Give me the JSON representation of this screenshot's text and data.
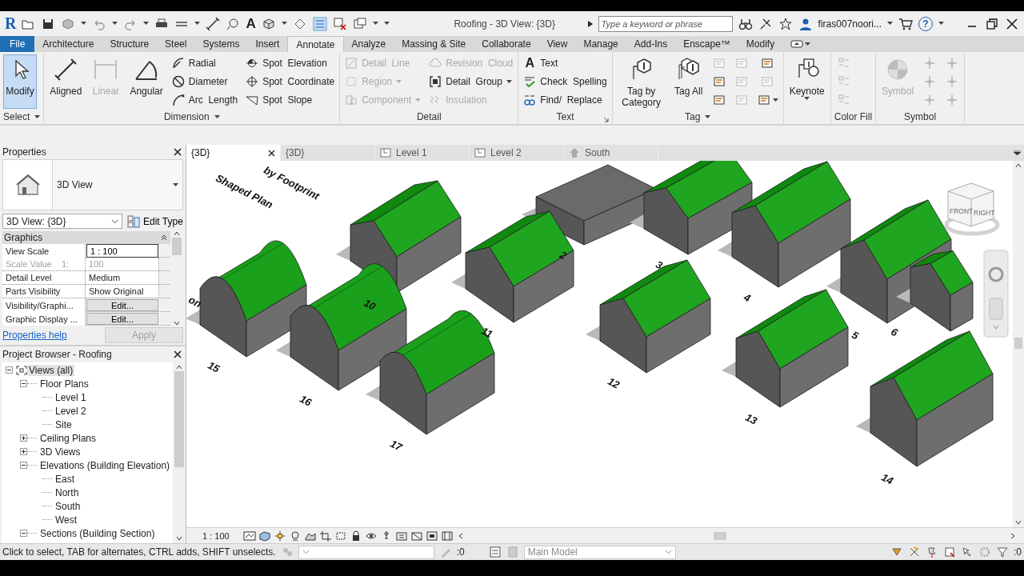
{
  "quick_access": {
    "logo": "R",
    "glyph": "A",
    "title": "Roofing - 3D View: {3D}",
    "search": {
      "placeholder": "Type a keyword or phrase"
    },
    "user": "firas007noori...",
    "help": "?"
  },
  "ribbon_tabs": [
    {
      "label": "File",
      "kind": "file",
      "selected": false
    },
    {
      "label": "Architecture",
      "kind": "tab",
      "selected": false
    },
    {
      "label": "Structure",
      "kind": "tab",
      "selected": false
    },
    {
      "label": "Steel",
      "kind": "tab",
      "selected": false
    },
    {
      "label": "Systems",
      "kind": "tab",
      "selected": false
    },
    {
      "label": "Insert",
      "kind": "tab",
      "selected": false
    },
    {
      "label": "Annotate",
      "kind": "tab",
      "selected": true
    },
    {
      "label": "Analyze",
      "kind": "tab",
      "selected": false
    },
    {
      "label": "Massing & Site",
      "kind": "tab",
      "selected": false
    },
    {
      "label": "Collaborate",
      "kind": "tab",
      "selected": false
    },
    {
      "label": "View",
      "kind": "tab",
      "selected": false
    },
    {
      "label": "Manage",
      "kind": "tab",
      "selected": false
    },
    {
      "label": "Add-Ins",
      "kind": "tab",
      "selected": false
    },
    {
      "label": "Enscape™",
      "kind": "tab",
      "selected": false
    },
    {
      "label": "Modify",
      "kind": "tab",
      "selected": false
    }
  ],
  "ribbon_panels": [
    {
      "title": "Select",
      "menu": true,
      "launcher": false,
      "columns": [
        [
          {
            "label": "Modify",
            "kind": "large",
            "selected": true,
            "disabled": false
          }
        ]
      ]
    },
    {
      "title": "Dimension",
      "menu": true,
      "launcher": false,
      "columns": [
        [
          {
            "label": "Aligned",
            "kind": "large",
            "disabled": false
          }
        ],
        [
          {
            "label": "Linear",
            "kind": "large",
            "disabled": true
          }
        ],
        [
          {
            "label": "Angular",
            "kind": "large",
            "disabled": false
          }
        ],
        [
          {
            "label": "Radial",
            "kind": "small",
            "disabled": false
          },
          {
            "label": "Diameter",
            "kind": "small",
            "disabled": false
          },
          {
            "label": "Arc  Length",
            "kind": "small",
            "disabled": false
          }
        ],
        [
          {
            "label": "Spot  Elevation",
            "kind": "small",
            "disabled": false
          },
          {
            "label": "Spot  Coordinate",
            "kind": "small",
            "disabled": false
          },
          {
            "label": "Spot  Slope",
            "kind": "small",
            "disabled": false
          }
        ]
      ]
    },
    {
      "title": "Detail",
      "menu": false,
      "launcher": false,
      "columns": [
        [
          {
            "label": "Detail  Line",
            "kind": "small",
            "disabled": true
          },
          {
            "label": "Region",
            "kind": "small",
            "disabled": true,
            "dropdown": true
          },
          {
            "label": "Component",
            "kind": "small",
            "disabled": true,
            "dropdown": true
          }
        ],
        [
          {
            "label": "Revision  Cloud",
            "kind": "small",
            "disabled": true
          },
          {
            "label": "Detail  Group",
            "kind": "small",
            "disabled": false,
            "dropdown": true
          },
          {
            "label": "Insulation",
            "kind": "small",
            "disabled": true
          }
        ]
      ]
    },
    {
      "title": "Text",
      "menu": false,
      "launcher": true,
      "columns": [
        [
          {
            "label": "Text",
            "kind": "small",
            "glyph": "A",
            "disabled": false
          },
          {
            "label": "Check  Spelling",
            "kind": "small",
            "disabled": false
          },
          {
            "label": "Find/  Replace",
            "kind": "small",
            "disabled": false
          }
        ]
      ]
    },
    {
      "title": "Tag",
      "menu": true,
      "launcher": false,
      "columns": [
        [
          {
            "label": "Tag by Category",
            "kind": "large",
            "disabled": false
          }
        ],
        [
          {
            "label": "Tag All",
            "kind": "large",
            "disabled": false
          }
        ],
        [
          {
            "kind": "icon",
            "disabled": true
          },
          {
            "kind": "icon",
            "disabled": false
          },
          {
            "kind": "icon",
            "disabled": false
          }
        ],
        [
          {
            "kind": "icon",
            "disabled": true
          },
          {
            "kind": "icon",
            "disabled": true
          },
          {
            "kind": "icon",
            "disabled": true
          }
        ],
        [
          {
            "kind": "icon",
            "disabled": false
          },
          {
            "kind": "icon",
            "disabled": true
          },
          {
            "kind": "icon",
            "disabled": false,
            "dropdown": true
          }
        ]
      ]
    },
    {
      "menu": false,
      "launcher": false,
      "columns": [
        [
          {
            "label": "Keynote",
            "kind": "large",
            "disabled": false,
            "dropdown": true
          }
        ]
      ]
    },
    {
      "title": "Color Fill",
      "menu": false,
      "launcher": false,
      "columns": [
        [
          {
            "kind": "icon",
            "disabled": true
          },
          {
            "kind": "icon",
            "disabled": true
          },
          {
            "kind": "icon",
            "disabled": true
          }
        ]
      ]
    },
    {
      "title": "Symbol",
      "menu": false,
      "launcher": false,
      "columns": [
        [
          {
            "label": "Symbol",
            "kind": "large",
            "disabled": true
          }
        ],
        [
          {
            "kind": "icon",
            "disabled": true
          },
          {
            "kind": "icon",
            "disabled": true
          },
          {
            "kind": "icon",
            "disabled": true
          }
        ],
        [
          {
            "kind": "icon",
            "disabled": true
          },
          {
            "kind": "icon",
            "disabled": true
          },
          {
            "kind": "icon",
            "disabled": true
          }
        ]
      ]
    }
  ],
  "properties": {
    "title": "Properties",
    "type_name": "3D View",
    "instance": "3D View: {3D}",
    "edit_type": "Edit Type",
    "group": "Graphics",
    "rows": [
      {
        "name": "View Scale",
        "value": "1 : 100",
        "kind": "field",
        "disabled": false
      },
      {
        "name": "Scale Value    1:",
        "value": "100",
        "kind": "text",
        "disabled": true
      },
      {
        "name": "Detail Level",
        "value": "Medium",
        "kind": "text",
        "disabled": false
      },
      {
        "name": "Parts Visibility",
        "value": "Show Original",
        "kind": "text",
        "disabled": false
      },
      {
        "name": "Visibility/Graphi...",
        "value": "Edit...",
        "kind": "button",
        "disabled": false
      },
      {
        "name": "Graphic Display ...",
        "value": "Edit...",
        "kind": "button",
        "disabled": false
      }
    ],
    "help": "Properties help",
    "apply": {
      "label": "Apply",
      "disabled": true
    }
  },
  "project_browser": {
    "title": "Project Browser - Roofing",
    "tree": [
      {
        "label": "Views (all)",
        "expanded": true,
        "selected": true,
        "children": [
          {
            "label": "Floor Plans",
            "expanded": true,
            "selected": false,
            "children": [
              {
                "label": "Level 1",
                "selected": false
              },
              {
                "label": "Level 2",
                "selected": false
              },
              {
                "label": "Site",
                "selected": false
              }
            ]
          },
          {
            "label": "Ceiling Plans",
            "expanded": false,
            "selected": false
          },
          {
            "label": "3D Views",
            "expanded": false,
            "selected": false
          },
          {
            "label": "Elevations (Building Elevation)",
            "expanded": true,
            "selected": false,
            "children": [
              {
                "label": "East",
                "selected": false
              },
              {
                "label": "North",
                "selected": false
              },
              {
                "label": "South",
                "selected": false
              },
              {
                "label": "West",
                "selected": false
              }
            ]
          },
          {
            "label": "Sections (Building Section)",
            "expanded": true,
            "selected": false
          }
        ]
      }
    ]
  },
  "view_tabs": [
    {
      "label": "{3D}",
      "kind": "model",
      "selected": true
    },
    {
      "label": "{3D}",
      "kind": "model",
      "selected": false
    },
    {
      "label": "Level 1",
      "kind": "plan",
      "selected": false
    },
    {
      "label": "Level 2",
      "kind": "plan",
      "selected": false
    },
    {
      "label": "South",
      "kind": "elevation",
      "selected": false
    }
  ],
  "model_view": {
    "notes": [
      "Shaped Plan",
      "by Footprint",
      "on"
    ],
    "labels": [
      "10",
      "2",
      "3",
      "4",
      "5",
      "6",
      "15",
      "16",
      "17",
      "11",
      "12",
      "13",
      "14"
    ],
    "viewcube": [
      "FRONT",
      "RIGHT"
    ]
  },
  "view_control": {
    "scale": "1 : 100"
  },
  "status_bar": {
    "message": "Click to select, TAB for alternates, CTRL adds, SHIFT unselects.",
    "count_1": ":0",
    "model": "Main Model",
    "count_2": ":0"
  }
}
